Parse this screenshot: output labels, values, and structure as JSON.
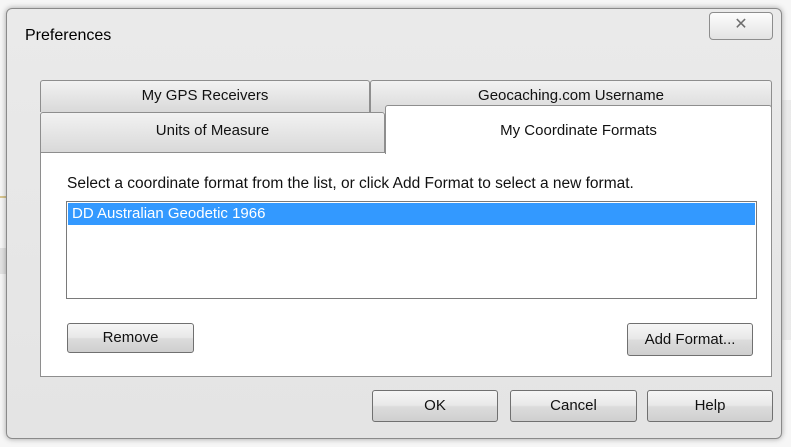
{
  "window": {
    "title": "Preferences",
    "close_glyph": "⌦",
    "close_icon": "close-icon"
  },
  "tabs": [
    {
      "label": "My GPS Receivers",
      "selected": false
    },
    {
      "label": "Geocaching.com Username",
      "selected": false
    },
    {
      "label": "Units of Measure",
      "selected": false
    },
    {
      "label": "My Coordinate Formats",
      "selected": true
    }
  ],
  "formats_panel": {
    "instruction": "Select a coordinate format from the list, or click Add Format to select a new format.",
    "formats": [
      {
        "label": "DD Australian Geodetic 1966",
        "selected": true
      }
    ],
    "remove_label": "Remove",
    "add_label": "Add Format..."
  },
  "footer": {
    "ok_label": "OK",
    "cancel_label": "Cancel",
    "help_label": "Help"
  },
  "colors": {
    "selection": "#3399ff",
    "selection_text": "#ffffff",
    "dialog_bg": "#e6e6e6"
  }
}
